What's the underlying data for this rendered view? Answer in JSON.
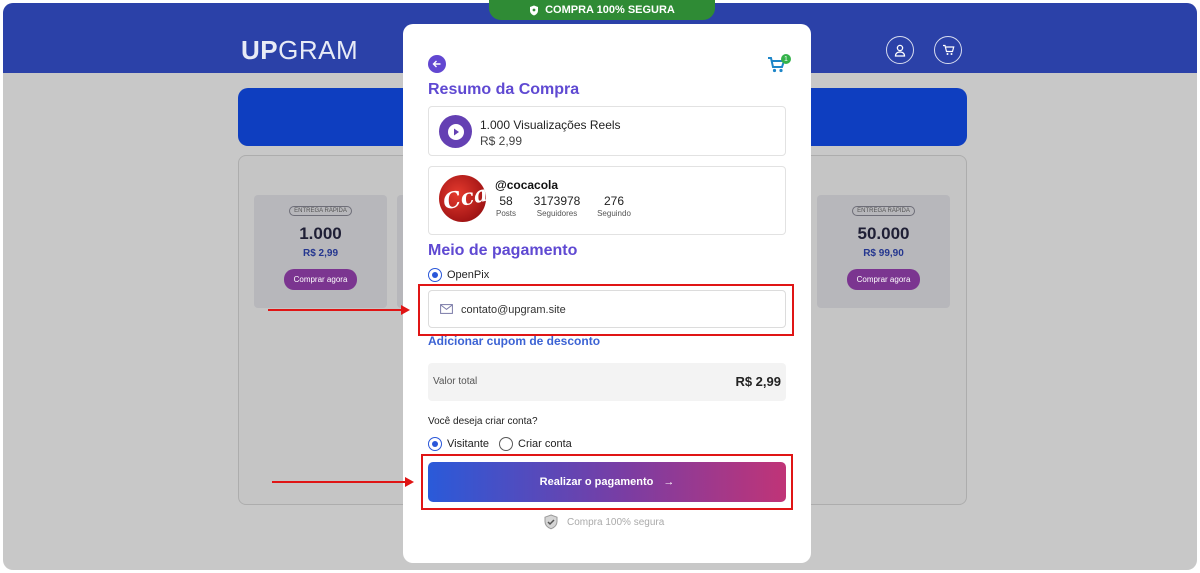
{
  "header": {
    "logo_bold": "UP",
    "logo_light": "GRAM",
    "secure_banner": "COMPRA 100% SEGURA"
  },
  "packages": [
    {
      "badge": "ENTREGA RÁPIDA",
      "quantity": "1.000",
      "price": "R$ 2,99",
      "button": "Comprar agora"
    },
    {
      "badge": "ENTREGA RÁPIDA",
      "quantity": "50.000",
      "price": "R$ 99,90",
      "button": "Comprar agora"
    }
  ],
  "modal": {
    "summary_title": "Resumo da Compra",
    "cart_count": "1",
    "product": {
      "name": "1.000 Visualizações Reels",
      "price": "R$ 2,99"
    },
    "profile": {
      "handle": "@cocacola",
      "avatar_text": "Cca",
      "stats": [
        {
          "value": "58",
          "label": "Posts"
        },
        {
          "value": "3173978",
          "label": "Seguidores"
        },
        {
          "value": "276",
          "label": "Seguindo"
        }
      ]
    },
    "payment_title": "Meio de pagamento",
    "payment_method": "OpenPix",
    "email": "contato@upgram.site",
    "coupon_link": "Adicionar cupom de desconto",
    "total_label": "Valor total",
    "total_value": "R$ 2,99",
    "account_question": "Você deseja criar conta?",
    "account_options": [
      "Visitante",
      "Criar conta"
    ],
    "pay_button": "Realizar o pagamento",
    "pay_arrow": "→",
    "secure_note": "Compra 100% segura"
  },
  "colors": {
    "header": "#2b41a8",
    "accent_purple": "#5f49d2",
    "link_blue": "#3c63d4",
    "highlight_red": "#e01515"
  }
}
